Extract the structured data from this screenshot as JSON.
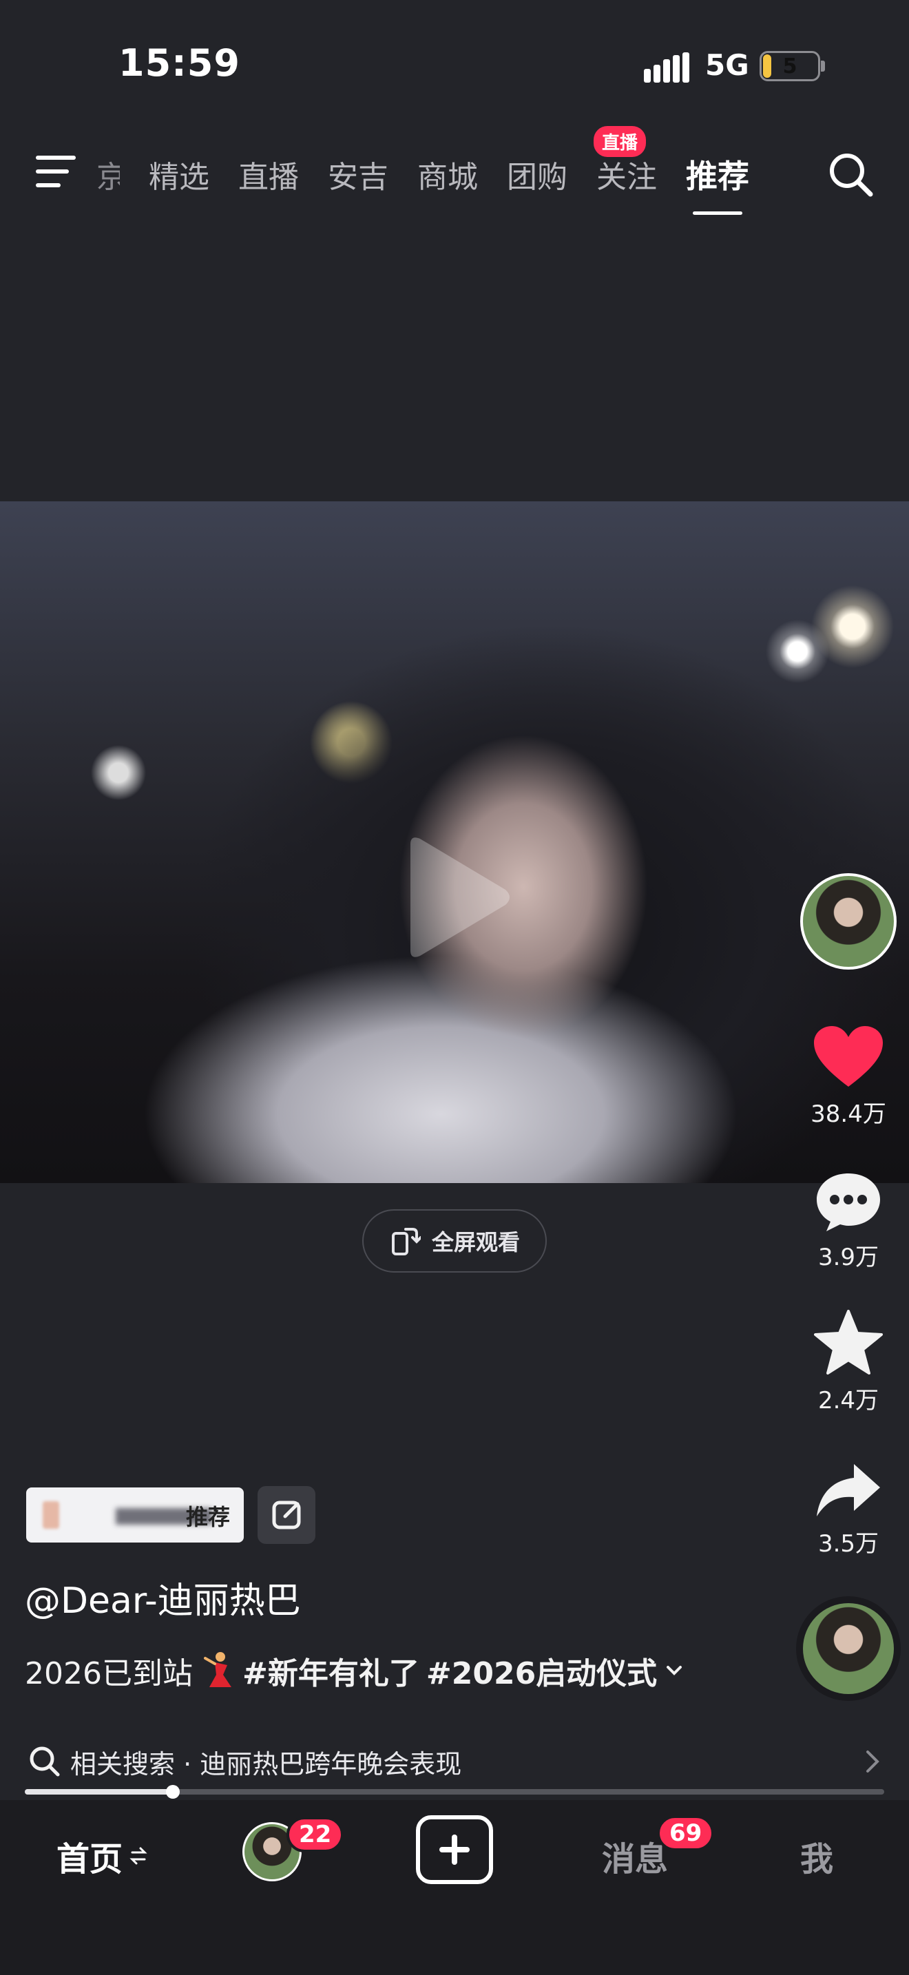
{
  "status_bar": {
    "time": "15:59",
    "network": "5G",
    "battery": "5"
  },
  "top_tabs": {
    "items": [
      {
        "label": "京",
        "partial": true
      },
      {
        "label": "精选"
      },
      {
        "label": "直播"
      },
      {
        "label": "安吉"
      },
      {
        "label": "商城"
      },
      {
        "label": "团购"
      },
      {
        "label": "关注",
        "badge": "直播"
      },
      {
        "label": "推荐",
        "active": true
      }
    ]
  },
  "video": {
    "fullscreen_label": "全屏观看"
  },
  "right_rail": {
    "likes": "38.4万",
    "comments": "3.9万",
    "favorites": "2.4万",
    "shares": "3.5万"
  },
  "caption": {
    "recommend_tag": "推荐",
    "author": "@Dear-迪丽热巴",
    "desc_prefix": "2026已到站",
    "hashtag1": "#新年有礼了",
    "hashtag2": "#2026启动仪式",
    "progress": 0.172
  },
  "related_search": {
    "label": "相关搜索 · 迪丽热巴跨年晚会表现"
  },
  "bottom_nav": {
    "home": "首页",
    "friends_badge": "22",
    "messages": "消息",
    "messages_badge": "69",
    "me": "我"
  },
  "colors": {
    "background": "#232429",
    "accent": "#fe2c55",
    "like": "#fe2c55"
  }
}
